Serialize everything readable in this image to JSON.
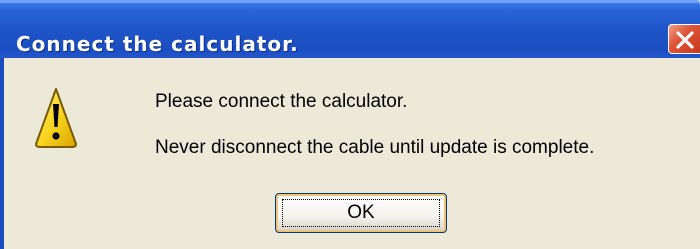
{
  "dialog": {
    "title": "Connect the calculator.",
    "message_line1": "Please connect the calculator.",
    "message_line2": "Never disconnect the cable until update is complete.",
    "ok_label": "OK"
  },
  "icons": {
    "warning": "warning-icon",
    "close": "close-icon"
  },
  "colors": {
    "titlebar": "#1f55c9",
    "dialog_bg": "#ece9d8",
    "close_button": "#d9472b",
    "warning_fill": "#f7d21c"
  }
}
